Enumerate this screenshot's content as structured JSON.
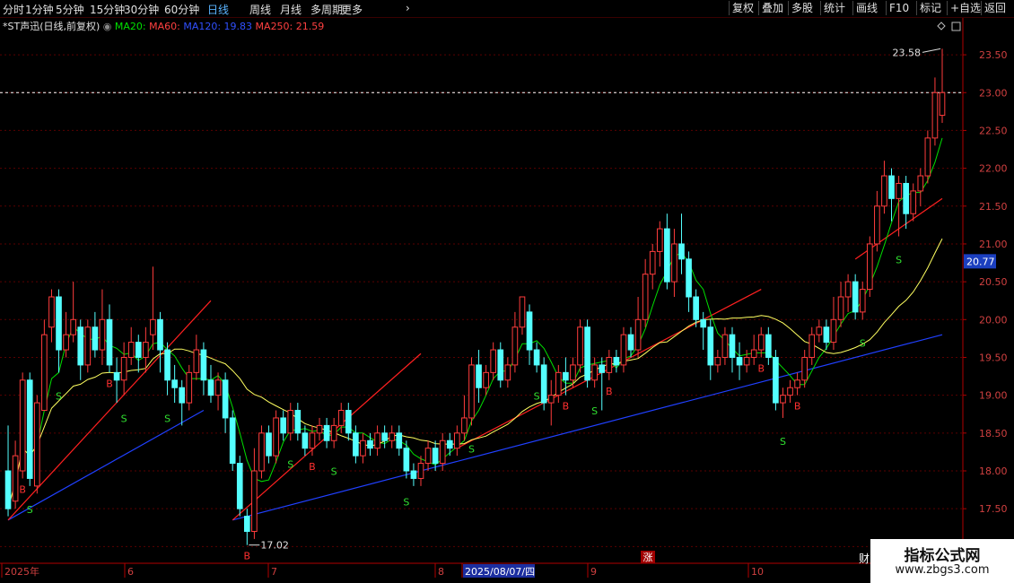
{
  "toolbar": {
    "periods": [
      "分时",
      "1分钟",
      "5分钟",
      "15分钟",
      "30分钟",
      "60分钟",
      "日线",
      "周线",
      "月线",
      "多周期",
      "更多"
    ],
    "active_period": "日线",
    "right_buttons": [
      "复权",
      "叠加",
      "多股",
      "统计",
      "画线",
      "F10",
      "标记",
      "+自选",
      "返回"
    ]
  },
  "legend": {
    "stock": "*ST声迅(日线,前复权)",
    "ma20": "MA20:",
    "ma60": "MA60:",
    "ma120": "MA120: 19.83",
    "ma250": "MA250: 21.59"
  },
  "colors": {
    "up": "#ff3c3c",
    "down": "#54ffff",
    "ma20": "#00e000",
    "ma60": "#ffff60",
    "trend_blue": "#2040ff",
    "trend_red": "#ff2020",
    "grid": "#5a0000",
    "axis": "#b00000"
  },
  "watermark": {
    "line1": "指标公式网",
    "line2": "www.zbgs3.com"
  },
  "marker_cai": "财",
  "chart_data": {
    "type": "candlestick",
    "ylim": [
      16.85,
      23.75
    ],
    "y_ticks": [
      "17.00",
      "17.50",
      "18.00",
      "18.50",
      "19.00",
      "19.50",
      "20.00",
      "20.50",
      "21.00",
      "21.50",
      "22.00",
      "22.50",
      "23.00",
      "23.50"
    ],
    "current_price": "20.77",
    "dashed_level": 23.0,
    "high_label": "23.58",
    "low_label": "17.02",
    "date_labels": [
      "2025年",
      "6",
      "7",
      "8",
      "2025/08/07/四",
      "9",
      "10"
    ],
    "zhang_label": "涨",
    "candles": [
      [
        18.0,
        17.5,
        18.6,
        17.4
      ],
      [
        17.6,
        18.2,
        18.4,
        17.5
      ],
      [
        18.0,
        19.2,
        19.3,
        17.9
      ],
      [
        19.2,
        17.9,
        19.3,
        17.8
      ],
      [
        17.8,
        18.9,
        19.0,
        17.7
      ],
      [
        18.8,
        19.8,
        20.0,
        18.8
      ],
      [
        19.9,
        20.3,
        20.4,
        19.7
      ],
      [
        20.3,
        19.6,
        20.4,
        19.3
      ],
      [
        19.6,
        19.8,
        20.1,
        19.5
      ],
      [
        19.8,
        20.0,
        20.5,
        19.7
      ],
      [
        19.9,
        19.4,
        20.0,
        19.2
      ],
      [
        19.4,
        19.9,
        20.0,
        19.3
      ],
      [
        19.9,
        19.6,
        20.1,
        19.5
      ],
      [
        19.6,
        20.0,
        20.4,
        19.4
      ],
      [
        20.0,
        19.4,
        20.2,
        19.3
      ],
      [
        19.3,
        19.2,
        19.5,
        18.9
      ],
      [
        19.2,
        19.5,
        19.7,
        19.0
      ],
      [
        19.5,
        19.7,
        19.9,
        19.4
      ],
      [
        19.7,
        19.5,
        19.8,
        19.3
      ],
      [
        19.5,
        19.7,
        19.9,
        19.3
      ],
      [
        19.8,
        20.0,
        20.7,
        19.6
      ],
      [
        20.0,
        19.6,
        20.1,
        19.3
      ],
      [
        19.6,
        19.2,
        19.7,
        19.0
      ],
      [
        19.2,
        19.1,
        19.4,
        18.9
      ],
      [
        19.1,
        18.9,
        19.2,
        18.6
      ],
      [
        18.9,
        19.3,
        19.4,
        18.8
      ],
      [
        19.3,
        19.6,
        19.8,
        19.2
      ],
      [
        19.6,
        19.2,
        19.7,
        19.0
      ],
      [
        19.2,
        19.0,
        19.4,
        18.9
      ],
      [
        19.0,
        19.2,
        19.3,
        18.8
      ],
      [
        19.2,
        18.7,
        19.3,
        18.5
      ],
      [
        18.7,
        18.1,
        18.8,
        18.0
      ],
      [
        18.1,
        17.5,
        18.2,
        17.4
      ],
      [
        17.4,
        17.2,
        17.5,
        17.02
      ],
      [
        17.2,
        18.0,
        18.3,
        17.1
      ],
      [
        18.0,
        18.5,
        18.6,
        17.9
      ],
      [
        18.5,
        18.2,
        18.6,
        18.1
      ],
      [
        18.2,
        18.7,
        18.8,
        18.1
      ],
      [
        18.7,
        18.5,
        18.8,
        18.4
      ],
      [
        18.5,
        18.8,
        18.9,
        18.4
      ],
      [
        18.8,
        18.5,
        18.9,
        18.4
      ],
      [
        18.5,
        18.3,
        18.6,
        18.2
      ],
      [
        18.3,
        18.5,
        18.6,
        18.2
      ],
      [
        18.5,
        18.6,
        18.7,
        18.4
      ],
      [
        18.6,
        18.4,
        18.7,
        18.3
      ],
      [
        18.4,
        18.6,
        18.7,
        18.3
      ],
      [
        18.6,
        18.8,
        18.9,
        18.5
      ],
      [
        18.8,
        18.5,
        18.9,
        18.4
      ],
      [
        18.5,
        18.2,
        18.6,
        18.1
      ],
      [
        18.2,
        18.4,
        18.5,
        18.1
      ],
      [
        18.4,
        18.3,
        18.5,
        18.2
      ],
      [
        18.3,
        18.5,
        18.6,
        18.2
      ],
      [
        18.5,
        18.4,
        18.6,
        18.3
      ],
      [
        18.4,
        18.5,
        18.6,
        18.3
      ],
      [
        18.5,
        18.3,
        18.6,
        18.2
      ],
      [
        18.3,
        18.0,
        18.4,
        17.9
      ],
      [
        18.0,
        17.9,
        18.1,
        17.8
      ],
      [
        17.9,
        18.1,
        18.2,
        17.8
      ],
      [
        18.1,
        18.3,
        18.4,
        18.0
      ],
      [
        18.3,
        18.1,
        18.4,
        18.0
      ],
      [
        18.1,
        18.4,
        18.5,
        18.0
      ],
      [
        18.4,
        18.3,
        18.5,
        18.2
      ],
      [
        18.3,
        18.5,
        18.6,
        18.2
      ],
      [
        18.5,
        18.7,
        19.0,
        18.4
      ],
      [
        18.7,
        19.4,
        19.5,
        18.6
      ],
      [
        19.4,
        19.1,
        19.6,
        18.9
      ],
      [
        19.1,
        19.3,
        19.4,
        19.0
      ],
      [
        19.3,
        19.6,
        19.7,
        19.2
      ],
      [
        19.6,
        19.2,
        19.7,
        19.1
      ],
      [
        19.2,
        19.4,
        19.5,
        19.1
      ],
      [
        19.4,
        19.9,
        20.1,
        19.3
      ],
      [
        19.9,
        20.3,
        20.3,
        19.8
      ],
      [
        20.1,
        19.6,
        20.2,
        19.4
      ],
      [
        19.6,
        19.4,
        19.7,
        19.3
      ],
      [
        19.4,
        18.9,
        19.5,
        18.8
      ],
      [
        18.9,
        19.0,
        19.2,
        18.6
      ],
      [
        19.0,
        19.3,
        19.4,
        18.9
      ],
      [
        19.3,
        19.2,
        19.5,
        19.0
      ],
      [
        19.2,
        19.4,
        19.5,
        19.1
      ],
      [
        19.4,
        19.9,
        20.0,
        19.3
      ],
      [
        19.9,
        19.2,
        20.0,
        19.1
      ],
      [
        19.2,
        19.4,
        19.5,
        19.1
      ],
      [
        19.4,
        19.3,
        19.5,
        18.8
      ],
      [
        19.3,
        19.5,
        19.6,
        19.2
      ],
      [
        19.5,
        19.4,
        19.6,
        19.3
      ],
      [
        19.4,
        19.8,
        19.9,
        19.3
      ],
      [
        19.8,
        19.6,
        19.9,
        19.5
      ],
      [
        19.6,
        20.0,
        20.3,
        19.5
      ],
      [
        20.0,
        20.6,
        20.8,
        19.9
      ],
      [
        20.6,
        20.9,
        21.0,
        20.4
      ],
      [
        20.9,
        21.2,
        21.3,
        20.7
      ],
      [
        21.2,
        20.5,
        21.4,
        20.4
      ],
      [
        20.5,
        21.0,
        21.2,
        20.3
      ],
      [
        21.0,
        20.8,
        21.4,
        20.6
      ],
      [
        20.8,
        20.3,
        20.9,
        20.1
      ],
      [
        20.3,
        20.0,
        20.4,
        19.9
      ],
      [
        20.0,
        19.9,
        20.1,
        19.6
      ],
      [
        19.9,
        19.4,
        20.0,
        19.2
      ],
      [
        19.4,
        19.5,
        19.6,
        19.3
      ],
      [
        19.5,
        19.8,
        19.9,
        19.4
      ],
      [
        19.8,
        19.5,
        19.9,
        19.3
      ],
      [
        19.5,
        19.4,
        19.7,
        19.2
      ],
      [
        19.4,
        19.5,
        19.6,
        19.3
      ],
      [
        19.5,
        19.6,
        19.8,
        19.4
      ],
      [
        19.6,
        19.8,
        19.9,
        19.5
      ],
      [
        19.8,
        19.5,
        19.9,
        19.4
      ],
      [
        19.5,
        18.9,
        19.6,
        18.8
      ],
      [
        18.9,
        19.0,
        19.1,
        18.7
      ],
      [
        19.0,
        19.1,
        19.2,
        18.9
      ],
      [
        19.1,
        19.2,
        19.3,
        19.0
      ],
      [
        19.2,
        19.5,
        19.6,
        19.1
      ],
      [
        19.5,
        19.8,
        19.9,
        19.4
      ],
      [
        19.8,
        19.9,
        20.0,
        19.7
      ],
      [
        19.9,
        19.7,
        20.0,
        19.6
      ],
      [
        19.7,
        20.0,
        20.3,
        19.6
      ],
      [
        20.0,
        20.3,
        20.5,
        19.9
      ],
      [
        20.3,
        20.5,
        20.6,
        20.1
      ],
      [
        20.5,
        20.1,
        20.6,
        20.0
      ],
      [
        20.1,
        20.4,
        20.5,
        20.0
      ],
      [
        20.4,
        21.0,
        21.1,
        20.3
      ],
      [
        21.0,
        21.5,
        21.7,
        20.9
      ],
      [
        21.5,
        21.9,
        22.1,
        21.4
      ],
      [
        21.9,
        21.6,
        22.0,
        21.3
      ],
      [
        21.6,
        21.8,
        21.9,
        21.1
      ],
      [
        21.8,
        21.4,
        21.9,
        21.2
      ],
      [
        21.4,
        21.7,
        21.8,
        21.3
      ],
      [
        21.7,
        21.9,
        22.0,
        21.5
      ],
      [
        21.9,
        22.4,
        22.5,
        21.8
      ],
      [
        22.4,
        23.0,
        23.2,
        22.3
      ],
      [
        22.7,
        23.0,
        23.58,
        22.6
      ]
    ],
    "signals": [
      {
        "i": 2,
        "t": "B"
      },
      {
        "i": 3,
        "t": "S"
      },
      {
        "i": 7,
        "t": "S"
      },
      {
        "i": 14,
        "t": "B"
      },
      {
        "i": 16,
        "t": "S"
      },
      {
        "i": 22,
        "t": "S"
      },
      {
        "i": 33,
        "t": "B"
      },
      {
        "i": 39,
        "t": "S"
      },
      {
        "i": 42,
        "t": "B"
      },
      {
        "i": 45,
        "t": "S"
      },
      {
        "i": 55,
        "t": "S"
      },
      {
        "i": 64,
        "t": "S"
      },
      {
        "i": 73,
        "t": "S"
      },
      {
        "i": 77,
        "t": "B"
      },
      {
        "i": 81,
        "t": "S"
      },
      {
        "i": 83,
        "t": "B"
      },
      {
        "i": 104,
        "t": "B"
      },
      {
        "i": 107,
        "t": "S"
      },
      {
        "i": 109,
        "t": "B"
      },
      {
        "i": 118,
        "t": "S"
      },
      {
        "i": 123,
        "t": "S"
      }
    ],
    "trendlines": [
      {
        "color": "blue",
        "from": [
          0,
          17.35
        ],
        "to": [
          27,
          18.8
        ]
      },
      {
        "color": "red",
        "from": [
          0,
          17.35
        ],
        "to": [
          28,
          20.25
        ]
      },
      {
        "color": "blue",
        "from": [
          31,
          17.35
        ],
        "to": [
          129,
          19.8
        ]
      },
      {
        "color": "red",
        "from": [
          31,
          17.35
        ],
        "to": [
          57,
          19.55
        ]
      },
      {
        "color": "red",
        "from": [
          62,
          18.3
        ],
        "to": [
          104,
          20.4
        ]
      },
      {
        "color": "red",
        "from": [
          117,
          20.8
        ],
        "to": [
          129,
          21.6
        ]
      }
    ]
  }
}
